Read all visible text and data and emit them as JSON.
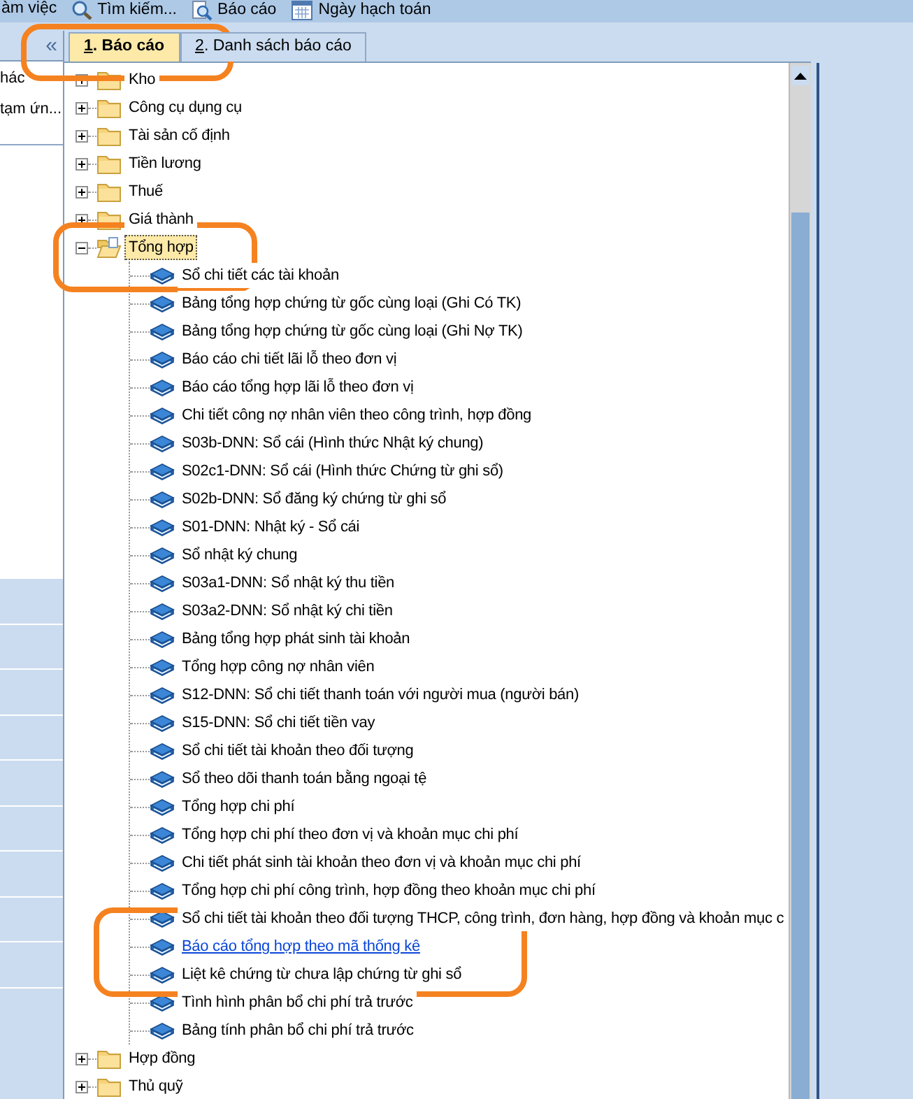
{
  "toolbar": [
    {
      "kind": "text",
      "label": "àm việc"
    },
    {
      "kind": "search",
      "label": "Tìm kiếm..."
    },
    {
      "kind": "report",
      "label": "Báo cáo"
    },
    {
      "kind": "calendar",
      "label": "Ngày hạch toán"
    }
  ],
  "left_panel": {
    "collapse_glyph": "«",
    "items": [
      "hác",
      "tạm ứn..."
    ]
  },
  "tabs": [
    {
      "hotkey": "1",
      "label": ". Báo cáo",
      "selected": true
    },
    {
      "hotkey": "2",
      "label": ". Danh sách báo cáo",
      "selected": false
    }
  ],
  "tree": [
    {
      "kind": "folder",
      "label": "Kho",
      "expanded": false,
      "selected": false
    },
    {
      "kind": "folder",
      "label": "Công cụ dụng cụ",
      "expanded": false,
      "selected": false
    },
    {
      "kind": "folder",
      "label": "Tài sản cố định",
      "expanded": false,
      "selected": false
    },
    {
      "kind": "folder",
      "label": "Tiền lương",
      "expanded": false,
      "selected": false
    },
    {
      "kind": "folder",
      "label": "Thuế",
      "expanded": false,
      "selected": false
    },
    {
      "kind": "folder",
      "label": "Giá thành",
      "expanded": false,
      "selected": false
    },
    {
      "kind": "folder",
      "label": "Tổng hợp",
      "expanded": true,
      "selected": true,
      "children": [
        {
          "kind": "report",
          "label": "Sổ chi tiết các tài khoản",
          "hovered": false
        },
        {
          "kind": "report",
          "label": "Bảng tổng hợp chứng từ gốc cùng loại (Ghi Có TK)",
          "hovered": false
        },
        {
          "kind": "report",
          "label": "Bảng tổng hợp chứng từ gốc cùng loại (Ghi Nợ TK)",
          "hovered": false
        },
        {
          "kind": "report",
          "label": "Báo cáo chi tiết lãi lỗ theo đơn vị",
          "hovered": false
        },
        {
          "kind": "report",
          "label": "Báo cáo tổng hợp lãi lỗ theo đơn vị",
          "hovered": false
        },
        {
          "kind": "report",
          "label": "Chi tiết công nợ nhân viên theo công trình, hợp đồng",
          "hovered": false
        },
        {
          "kind": "report",
          "label": "S03b-DNN: Sổ cái (Hình thức Nhật ký chung)",
          "hovered": false
        },
        {
          "kind": "report",
          "label": "S02c1-DNN: Sổ cái (Hình thức Chứng từ ghi sổ)",
          "hovered": false
        },
        {
          "kind": "report",
          "label": "S02b-DNN: Sổ đăng ký chứng từ ghi sổ",
          "hovered": false
        },
        {
          "kind": "report",
          "label": "S01-DNN: Nhật ký - Sổ cái",
          "hovered": false
        },
        {
          "kind": "report",
          "label": "Sổ nhật ký chung",
          "hovered": false
        },
        {
          "kind": "report",
          "label": "S03a1-DNN: Sổ nhật ký thu tiền",
          "hovered": false
        },
        {
          "kind": "report",
          "label": "S03a2-DNN: Sổ nhật ký chi tiền",
          "hovered": false
        },
        {
          "kind": "report",
          "label": "Bảng tổng hợp phát sinh tài khoản",
          "hovered": false
        },
        {
          "kind": "report",
          "label": "Tổng hợp công nợ nhân viên",
          "hovered": false
        },
        {
          "kind": "report",
          "label": "S12-DNN: Sổ chi tiết thanh toán với người mua (người bán)",
          "hovered": false
        },
        {
          "kind": "report",
          "label": "S15-DNN: Sổ chi tiết tiền vay",
          "hovered": false
        },
        {
          "kind": "report",
          "label": "Sổ chi tiết tài khoản theo đối tượng",
          "hovered": false
        },
        {
          "kind": "report",
          "label": "Sổ theo dõi thanh toán bằng ngoại tệ",
          "hovered": false
        },
        {
          "kind": "report",
          "label": "Tổng hợp chi phí",
          "hovered": false
        },
        {
          "kind": "report",
          "label": "Tổng hợp chi phí theo đơn vị và khoản mục chi phí",
          "hovered": false
        },
        {
          "kind": "report",
          "label": "Chi tiết phát sinh tài khoản theo đơn vị và khoản mục chi phí",
          "hovered": false
        },
        {
          "kind": "report",
          "label": "Tổng hợp chi phí công trình, hợp đồng theo khoản mục chi phí",
          "hovered": false
        },
        {
          "kind": "report",
          "label": "Sổ chi tiết tài khoản theo đối tượng THCP, công trình, đơn hàng, hợp đồng và khoản mục c",
          "hovered": false
        },
        {
          "kind": "report",
          "label": "Báo cáo tổng hợp theo mã thống kê",
          "hovered": true
        },
        {
          "kind": "report",
          "label": "Liệt kê chứng từ chưa lập chứng từ ghi sổ",
          "hovered": false
        },
        {
          "kind": "report",
          "label": "Tình hình phân bổ chi phí trả trước",
          "hovered": false
        },
        {
          "kind": "report",
          "label": "Bảng tính phân bổ chi phí trả trước",
          "hovered": false
        }
      ]
    },
    {
      "kind": "folder",
      "label": "Hợp đồng",
      "expanded": false,
      "selected": false
    },
    {
      "kind": "folder",
      "label": "Thủ quỹ",
      "expanded": false,
      "selected": false
    }
  ]
}
